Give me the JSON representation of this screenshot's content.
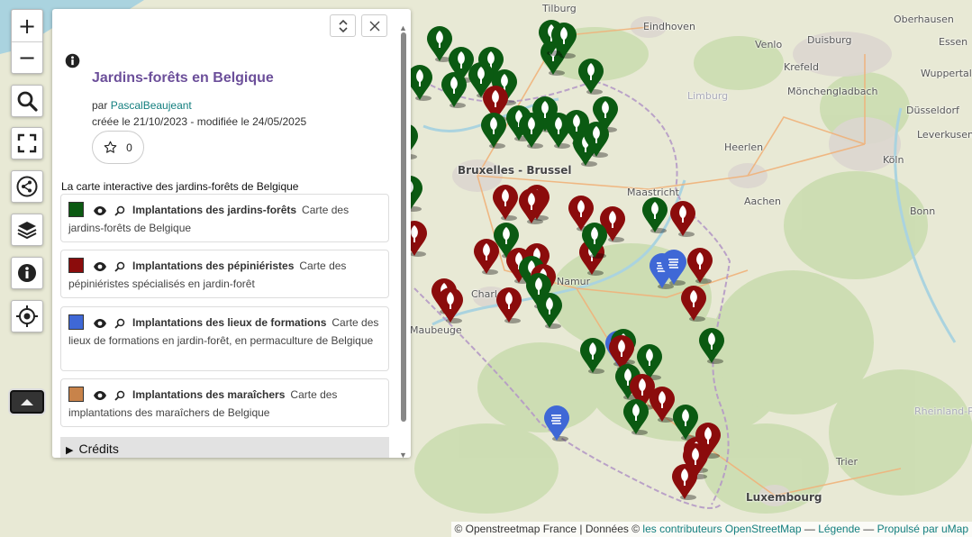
{
  "map": {
    "places": [
      {
        "name": "Tilburg",
        "cls": ""
      },
      {
        "name": "Eindhoven",
        "cls": ""
      },
      {
        "name": "Oberhausen",
        "cls": ""
      },
      {
        "name": "Venlo",
        "cls": ""
      },
      {
        "name": "Duisburg",
        "cls": ""
      },
      {
        "name": "Essen",
        "cls": ""
      },
      {
        "name": "Krefeld",
        "cls": ""
      },
      {
        "name": "Wuppertal",
        "cls": ""
      },
      {
        "name": "Mönchengladbach",
        "cls": ""
      },
      {
        "name": "Düsseldorf",
        "cls": ""
      },
      {
        "name": "Limburg",
        "cls": "region"
      },
      {
        "name": "Leverkusen",
        "cls": ""
      },
      {
        "name": "Heerlen",
        "cls": ""
      },
      {
        "name": "Köln",
        "cls": ""
      },
      {
        "name": "Bruxelles - Brussel",
        "cls": "big"
      },
      {
        "name": "Maastricht",
        "cls": ""
      },
      {
        "name": "Aachen",
        "cls": ""
      },
      {
        "name": "Bonn",
        "cls": ""
      },
      {
        "name": "Charleroi",
        "cls": ""
      },
      {
        "name": "Namur",
        "cls": ""
      },
      {
        "name": "Maubeuge",
        "cls": ""
      },
      {
        "name": "Rheinland-Pfalz",
        "cls": "region"
      },
      {
        "name": "Trier",
        "cls": ""
      },
      {
        "name": "Luxembourg",
        "cls": "big"
      }
    ]
  },
  "controls": {
    "zoom_in": "+",
    "zoom_out": "−"
  },
  "panel": {
    "title": "Jardins-forêts en Belgique",
    "author_prefix": "par",
    "author": "PascalBeaujeant",
    "dates": "créée le 21/10/2023 - modifiée le 24/05/2025",
    "stars": "0",
    "description": "La carte interactive des jardins-forêts de Belgique",
    "layers": [
      {
        "name": "Implantations des jardins-forêts",
        "desc": "Carte des jardins-forêts de Belgique",
        "color": "#0b5a12"
      },
      {
        "name": "Implantations des pépiniéristes",
        "desc": "Carte des pépiniéristes spécialisés en jardin-forêt",
        "color": "#8b0c0c"
      },
      {
        "name": "Implantations des lieux de formations",
        "desc": "Carte des lieux de formations en jardin-forêt, en permaculture de Belgique",
        "color": "#3f68d6"
      },
      {
        "name": "Implantations des maraîchers",
        "desc": "Carte des implantations des maraîchers de Belgique",
        "color": "#c8834a"
      }
    ],
    "credits": "Crédits"
  },
  "attribution": {
    "osm_france": "© Openstreetmap France | Données ©",
    "contributors": "les contributeurs OpenStreetMap",
    "sep1": "—",
    "legend": "Légende",
    "sep2": "—",
    "powered": "Propulsé par uMap"
  },
  "colors": {
    "green_marker": "#0b5a12",
    "red_marker": "#8b0c0c",
    "blue_marker": "#3f68d6",
    "title": "#6c4f9a",
    "link": "#127e7e"
  }
}
